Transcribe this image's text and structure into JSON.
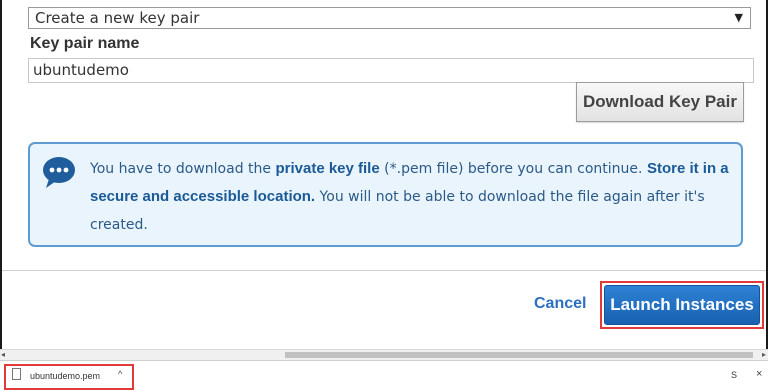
{
  "key_pair_select": {
    "value": "Create a new key pair"
  },
  "key_pair_name": {
    "label": "Key pair name",
    "value": "ubuntudemo"
  },
  "download_button": {
    "label": "Download Key Pair"
  },
  "info": {
    "text_1": "You have to download the ",
    "bold_1": "private key file",
    "text_2": " (*.pem file) before you can continue. ",
    "bold_2": "Store it in a secure and accessible location.",
    "text_3": " You will not be able to download the file again after it's created."
  },
  "footer": {
    "cancel_label": "Cancel",
    "launch_label": "Launch Instances"
  },
  "download_shelf": {
    "file_name": "ubuntudemo.pem",
    "show_all_label": "S"
  },
  "colors": {
    "primary": "#1a60b0",
    "highlight_outline": "#e23a3a",
    "info_border": "#5e9bd0"
  },
  "icons": {
    "info": "chat-bubble-icon",
    "dropdown": "chevron-down-icon",
    "file": "file-icon"
  }
}
